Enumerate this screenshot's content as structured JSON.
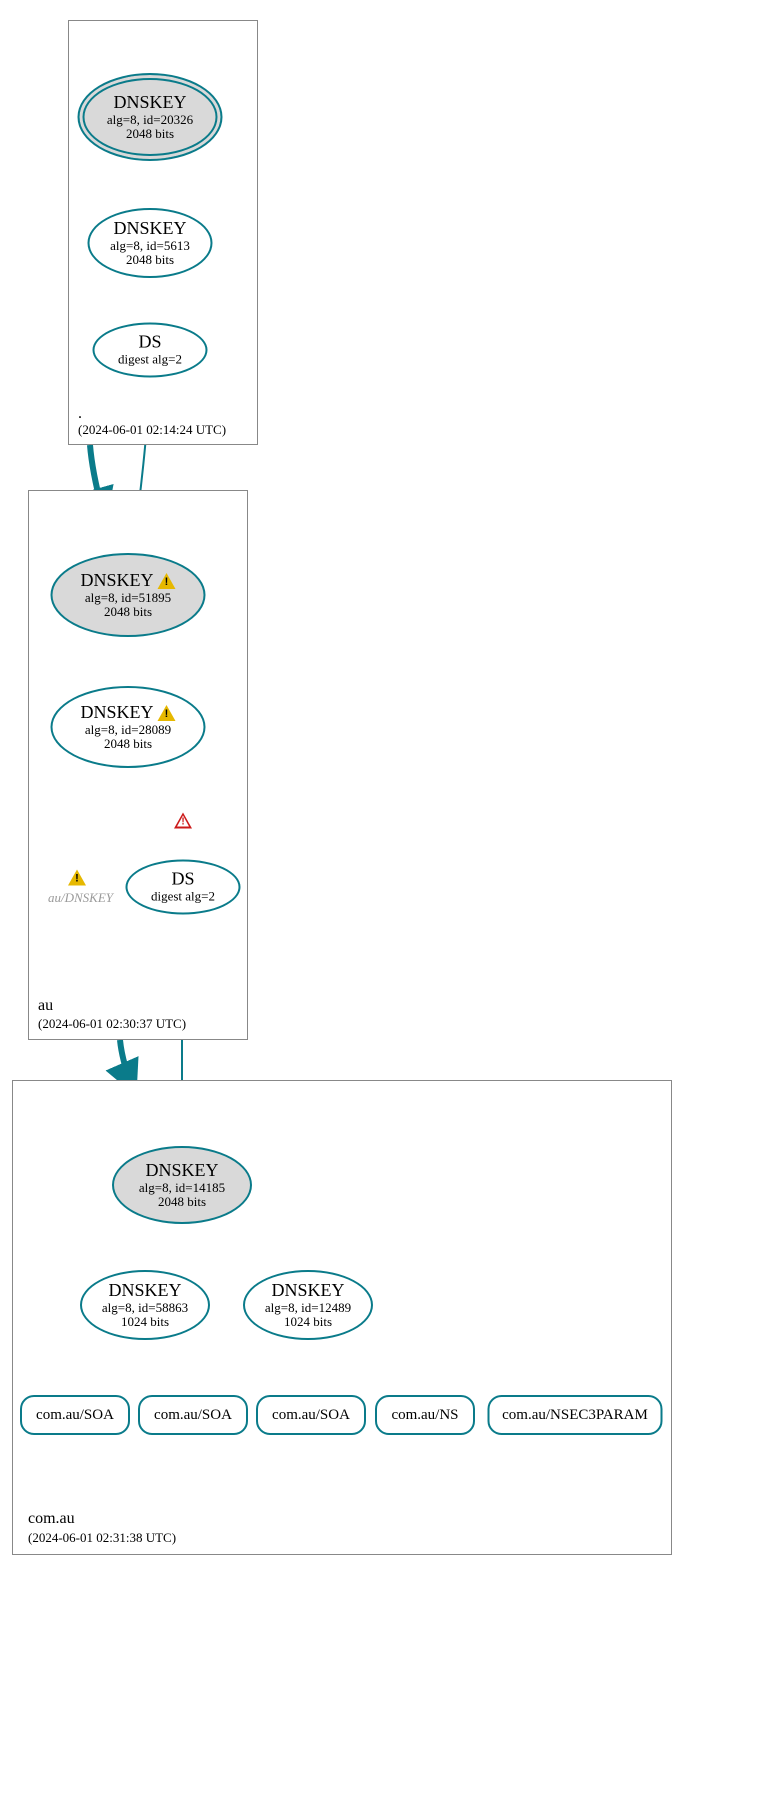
{
  "colors": {
    "stroke": "#0a7b8a"
  },
  "zones": {
    "root": {
      "name": ".",
      "timestamp": "(2024-06-01 02:14:24 UTC)"
    },
    "au": {
      "name": "au",
      "timestamp": "(2024-06-01 02:30:37 UTC)"
    },
    "comau": {
      "name": "com.au",
      "timestamp": "(2024-06-01 02:31:38 UTC)"
    }
  },
  "nodes": {
    "root_ksk": {
      "title": "DNSKEY",
      "sub": "alg=8, id=20326",
      "sub2": "2048 bits"
    },
    "root_zsk": {
      "title": "DNSKEY",
      "sub": "alg=8, id=5613",
      "sub2": "2048 bits"
    },
    "root_ds": {
      "title": "DS",
      "sub": "digest alg=2"
    },
    "au_ksk": {
      "title": "DNSKEY",
      "sub": "alg=8, id=51895",
      "sub2": "2048 bits",
      "warn": true
    },
    "au_zsk": {
      "title": "DNSKEY",
      "sub": "alg=8, id=28089",
      "sub2": "2048 bits",
      "warn": true
    },
    "au_ds": {
      "title": "DS",
      "sub": "digest alg=2"
    },
    "au_dnskey_text": "au/DNSKEY",
    "comau_ksk": {
      "title": "DNSKEY",
      "sub": "alg=8, id=14185",
      "sub2": "2048 bits"
    },
    "comau_zsk1": {
      "title": "DNSKEY",
      "sub": "alg=8, id=58863",
      "sub2": "1024 bits"
    },
    "comau_zsk2": {
      "title": "DNSKEY",
      "sub": "alg=8, id=12489",
      "sub2": "1024 bits"
    }
  },
  "records": {
    "r1": "com.au/SOA",
    "r2": "com.au/SOA",
    "r3": "com.au/SOA",
    "r4": "com.au/NS",
    "r5": "com.au/NSEC3PARAM"
  }
}
